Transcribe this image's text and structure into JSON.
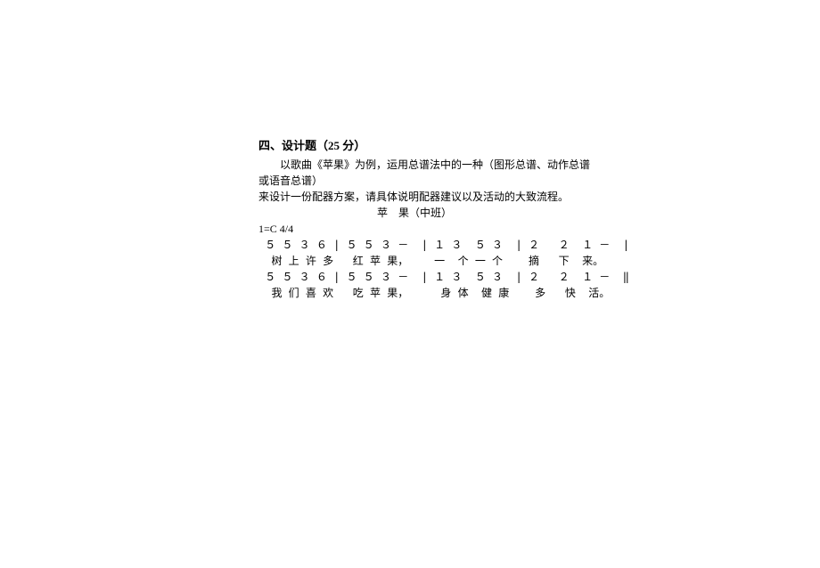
{
  "section_title": "四、设计题（25 分）",
  "prompt_line1": "以歌曲《苹果》为例，运用总谱法中的一种（图形总谱、动作总谱或语音总谱）",
  "prompt_line2": "来设计一份配器方案，请具体说明配器建议以及活动的大致流程。",
  "song_title": "苹　果（中班）",
  "key_meta": "1=C 4/4",
  "score_row1": " ５ ５ ３ ６ | ５ ５ ３ －  | １ ３  ５ ３  | ２   ２  １ －  |",
  "lyric_row1": "  树 上 许 多   红 苹 果，    一  个 一 个    摘   下  来。",
  "score_row2": " ５ ５ ３ ６ | ５ ５ ３ －  | １ ３  ５ ３  | ２   ２  １ －  ‖",
  "lyric_row2": "  我 们 喜 欢   吃 苹 果，     身 体  健 康    多   快  活。"
}
